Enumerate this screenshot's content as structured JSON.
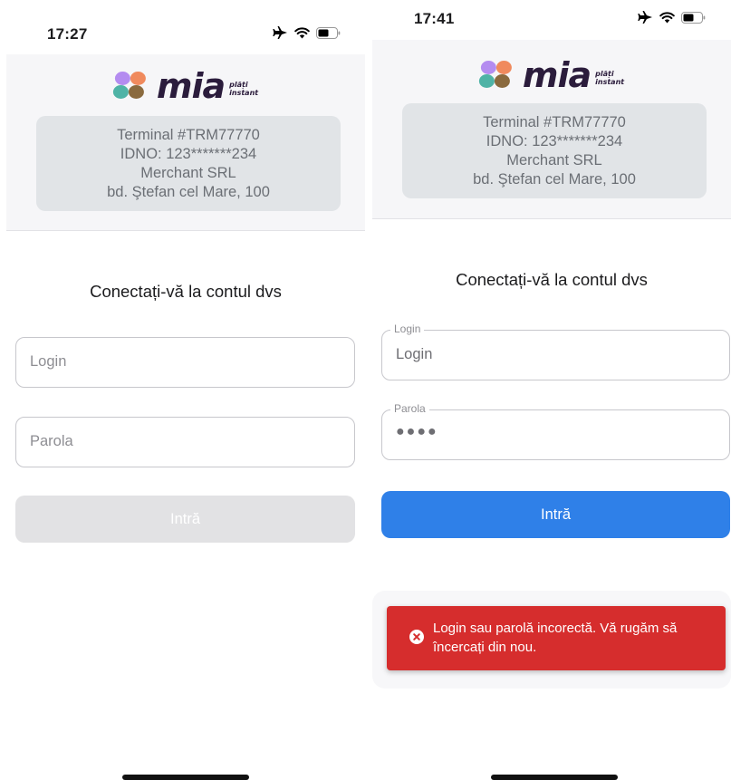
{
  "screens": {
    "left": {
      "status": {
        "time": "17:27"
      },
      "logo": {
        "word": "mia",
        "sub_line1": "plăți",
        "sub_line2": "instant"
      },
      "merchant": {
        "terminal": "Terminal #TRM77770",
        "idno": "IDNO: 123*******234",
        "name": "Merchant SRL",
        "address": "bd. Ştefan cel Mare, 100"
      },
      "form": {
        "title": "Conectați-vă la contul dvs",
        "login_placeholder": "Login",
        "password_placeholder": "Parola",
        "submit_label": "Intră"
      }
    },
    "right": {
      "status": {
        "time": "17:41"
      },
      "logo": {
        "word": "mia",
        "sub_line1": "plăți",
        "sub_line2": "instant"
      },
      "merchant": {
        "terminal": "Terminal #TRM77770",
        "idno": "IDNO: 123*******234",
        "name": "Merchant SRL",
        "address": "bd. Ştefan cel Mare, 100"
      },
      "form": {
        "title": "Conectați-vă la contul dvs",
        "login_label": "Login",
        "login_value": "Login",
        "password_label": "Parola",
        "password_value": "●●●●",
        "submit_label": "Intră"
      },
      "toast": {
        "message": "Login sau parolă incorectă. Vă rugăm să încercați din nou.",
        "icon": "error-circle-icon"
      }
    }
  },
  "icons": [
    "airplane-icon",
    "wifi-icon",
    "battery-icon",
    "error-circle-icon"
  ],
  "colors": {
    "primary": "#2f80e8",
    "disabled": "#e2e2e4",
    "error": "#d62d2d",
    "header_bg": "#f6f6f8",
    "merchant_box": "#e1e4e7"
  }
}
